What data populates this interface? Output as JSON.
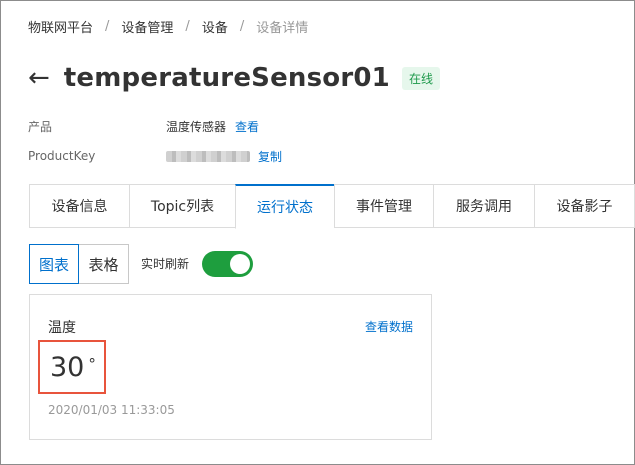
{
  "breadcrumb": [
    "物联网平台",
    "设备管理",
    "设备",
    "设备详情"
  ],
  "device": {
    "name": "temperatureSensor01",
    "status": "在线",
    "product_label": "产品",
    "product_value": "温度传感器",
    "product_link": "查看",
    "productkey_label": "ProductKey",
    "productkey_copy": "复制"
  },
  "tabs": [
    {
      "label": "设备信息",
      "active": false
    },
    {
      "label": "Topic列表",
      "active": false
    },
    {
      "label": "运行状态",
      "active": true
    },
    {
      "label": "事件管理",
      "active": false
    },
    {
      "label": "服务调用",
      "active": false
    },
    {
      "label": "设备影子",
      "active": false
    }
  ],
  "view": {
    "chart_label": "图表",
    "table_label": "表格",
    "realtime_label": "实时刷新",
    "realtime_on": true
  },
  "card": {
    "title": "温度",
    "link": "查看数据",
    "value": "30",
    "unit": "°",
    "timestamp": "2020/01/03 11:33:05"
  },
  "colors": {
    "accent": "#0070cc",
    "online_badge_bg": "#e6f7ec",
    "online_badge_text": "#1f9a4c",
    "toggle_on": "#1e9e3e",
    "highlight": "#e8543c"
  }
}
